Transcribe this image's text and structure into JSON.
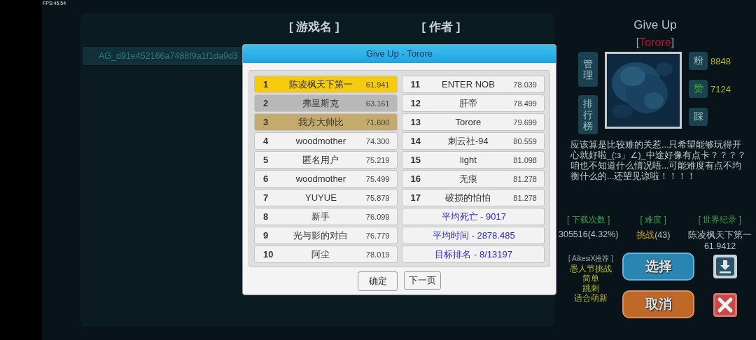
{
  "fps": "FPS:45.54",
  "list": {
    "columns": [
      "[ 游戏名 ]",
      "[ 作者 ]"
    ],
    "rows": [
      {
        "name": "AG_d91e452166a7488f9a1f1da9d3"
      }
    ]
  },
  "dialog": {
    "title": "Give Up - Torore",
    "rankings": [
      {
        "rank": "1",
        "name": "陈凌枫天下第一",
        "score": "61.941",
        "color": "#f5cb10"
      },
      {
        "rank": "2",
        "name": "弗里斯克",
        "score": "63.161",
        "color": "#b8b8b8"
      },
      {
        "rank": "3",
        "name": "我方大帅比",
        "score": "71.600",
        "color": "#c4aa6c"
      },
      {
        "rank": "4",
        "name": "woodmother",
        "score": "74.300",
        "color": "#f2f2f2"
      },
      {
        "rank": "5",
        "name": "匿名用户",
        "score": "75.219",
        "color": "#f2f2f2"
      },
      {
        "rank": "6",
        "name": "woodmother",
        "score": "75.499",
        "color": "#f2f2f2"
      },
      {
        "rank": "7",
        "name": "YUYUE",
        "score": "75.879",
        "color": "#f2f2f2"
      },
      {
        "rank": "8",
        "name": "新手",
        "score": "76.099",
        "color": "#f2f2f2"
      },
      {
        "rank": "9",
        "name": "光与影的对白",
        "score": "76.779",
        "color": "#f2f2f2"
      },
      {
        "rank": "10",
        "name": "阿尘",
        "score": "78.019",
        "color": "#f2f2f2"
      },
      {
        "rank": "11",
        "name": "ENTER NOB",
        "score": "78.039",
        "color": "#f2f2f2"
      },
      {
        "rank": "12",
        "name": "肝帝",
        "score": "78.499",
        "color": "#f2f2f2"
      },
      {
        "rank": "13",
        "name": "Torore",
        "score": "79.699",
        "color": "#f2f2f2"
      },
      {
        "rank": "14",
        "name": "刺云社-94",
        "score": "80.559",
        "color": "#f2f2f2"
      },
      {
        "rank": "15",
        "name": "light",
        "score": "81.098",
        "color": "#f2f2f2"
      },
      {
        "rank": "16",
        "name": "无痕",
        "score": "81.278",
        "color": "#f2f2f2"
      },
      {
        "rank": "17",
        "name": "破损的怕怕",
        "score": "81.278",
        "color": "#f2f2f2"
      }
    ],
    "stats": [
      "平均死亡 - 9017",
      "平均时间 - 2878.485",
      "目标排名 - 8/13197"
    ],
    "buttons": [
      "确定",
      "下一页"
    ]
  },
  "level": {
    "title": "Give Up",
    "author": {
      "open": "[",
      "name": "Torore",
      "close": "]"
    },
    "left_buttons": [
      "管理",
      "排行榜"
    ],
    "counters": [
      {
        "label": "粉",
        "value": "8848",
        "kind": "plain"
      },
      {
        "label": "赞",
        "value": "7124",
        "kind": "like"
      },
      {
        "label": "踩",
        "kind": "plain"
      }
    ],
    "description": "应该算是比较难的关惹...只希望能够玩得开心就好啦_(:з」∠)_中途好像有点卡？？？？咱也不知道什么情况唔...可能难度有点不均衡什么的...还望见谅啦！！！！",
    "downloads": {
      "label": "[ 下载次数 ]",
      "value": "305516(4.32%)"
    },
    "difficulty": {
      "label": "[ 难度 ]",
      "name": "挑战",
      "count": "(43)"
    },
    "record": {
      "label": "[ 世界纪录 ]",
      "holder": "陈凌枫天下第一",
      "time": "61.9412"
    },
    "recommend": {
      "label": "[ AikesiX推荐 ]",
      "lines": [
        "愚人节挑战",
        "简单",
        "跳刺",
        "适合萌新"
      ]
    },
    "select_button": "选择",
    "cancel_button": "取消"
  }
}
